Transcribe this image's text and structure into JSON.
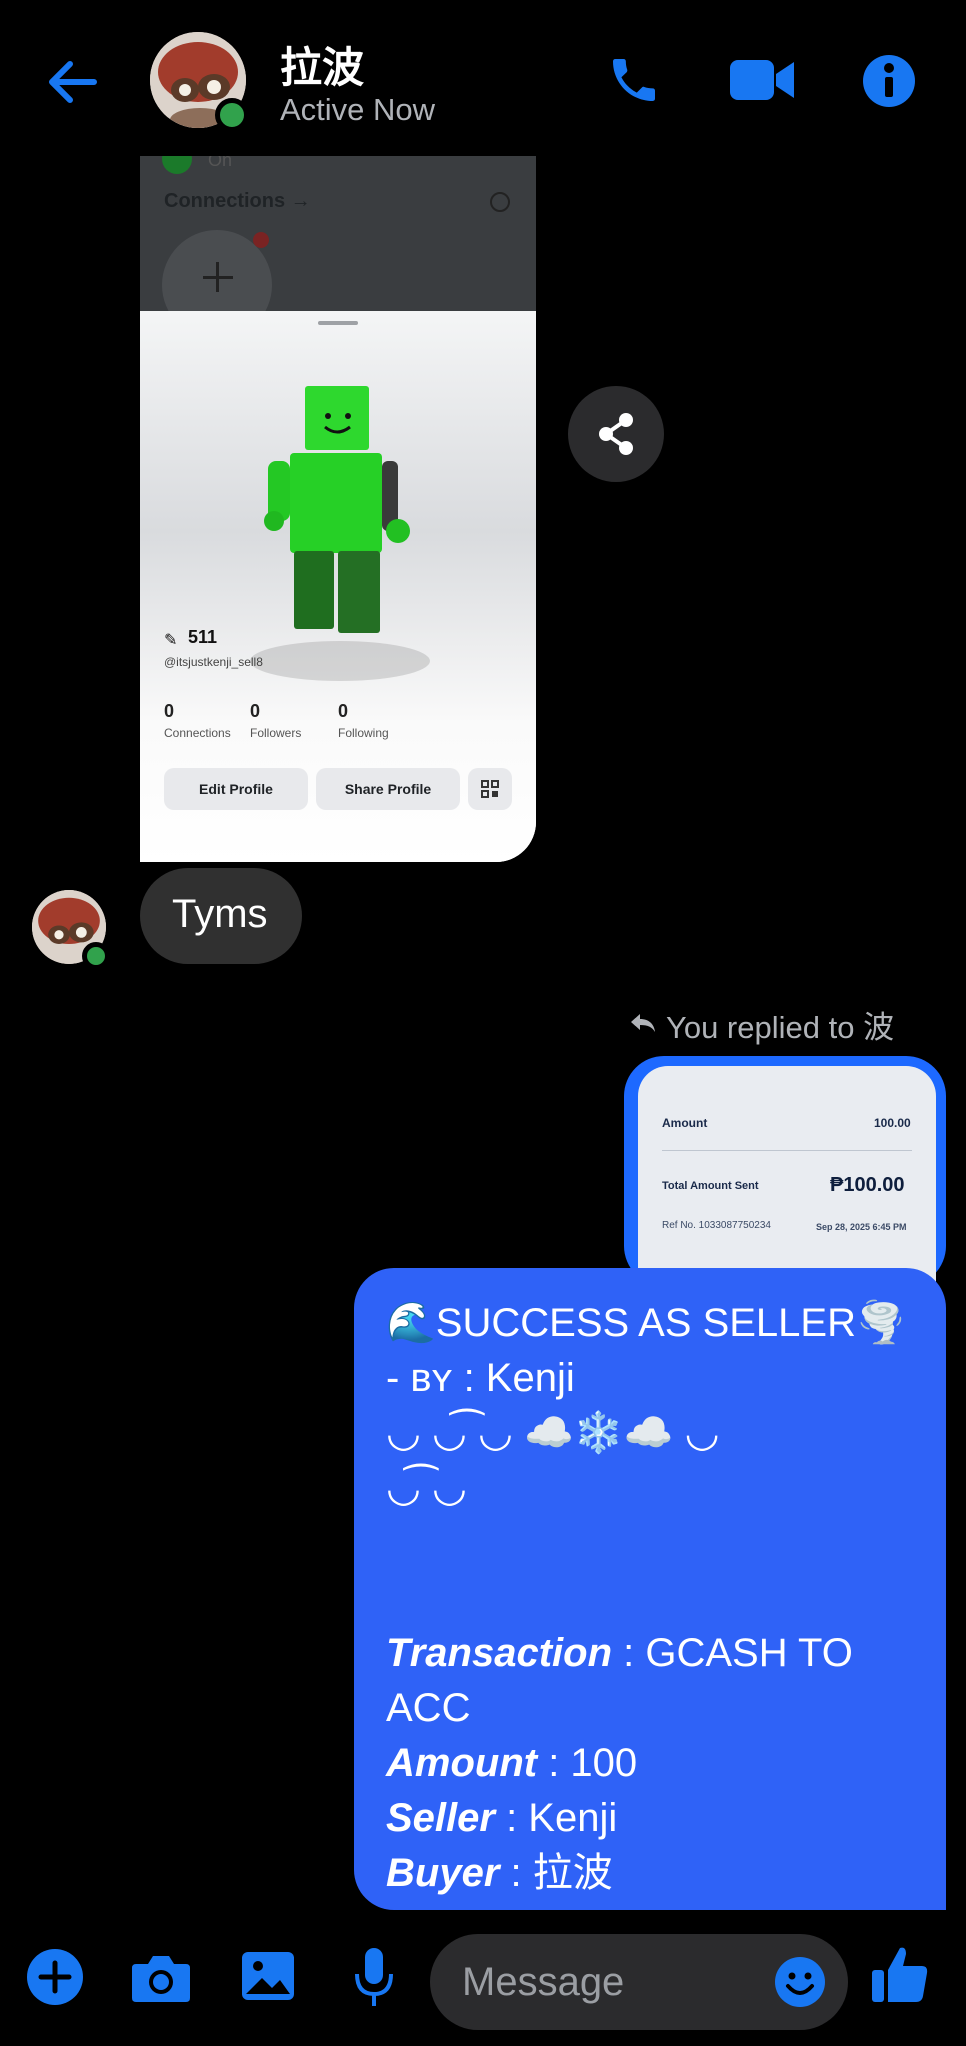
{
  "header": {
    "contact_name": "拉波",
    "status": "Active Now"
  },
  "shared_profile": {
    "section_label": "Connections →",
    "stat_badge": "511",
    "username": "@itsjustkenji_sell8",
    "stats": [
      {
        "value": "0",
        "label": "Connections"
      },
      {
        "value": "0",
        "label": "Followers"
      },
      {
        "value": "0",
        "label": "Following"
      }
    ],
    "edit_button": "Edit Profile",
    "share_button": "Share Profile",
    "partial_top_text": "On"
  },
  "incoming_message": {
    "text": "Tyms"
  },
  "reply_header": "You replied to 波",
  "reply_preview": {
    "amount_label": "Amount",
    "amount_value": "100.00",
    "total_label": "Total Amount Sent",
    "total_value": "₱100.00",
    "ref_label": "Ref No. 1033087750234",
    "ref_date": "Sep 28, 2025 6:45 PM"
  },
  "outgoing_message": {
    "line1": "🌊SUCCESS AS SELLER🌪️",
    "line2": "- ʙʏ : Kenji",
    "line3": "◡ ◡͡ ◡ ☁️❄️☁️ ◡",
    "line4": "◡͡ ◡",
    "transaction_label": "Transaction",
    "transaction_value": " : GCASH TO ACC",
    "amount_label": "Amount",
    "amount_value": " : 100",
    "seller_label": "Seller",
    "seller_value": " : Kenji",
    "buyer_label": "Buyer",
    "buyer_value": " : 拉波"
  },
  "composer": {
    "placeholder": "Message"
  },
  "colors": {
    "accent": "#1877f2",
    "bubble_out": "#2f62f7",
    "bubble_in": "#303030",
    "presence": "#31a24c"
  }
}
